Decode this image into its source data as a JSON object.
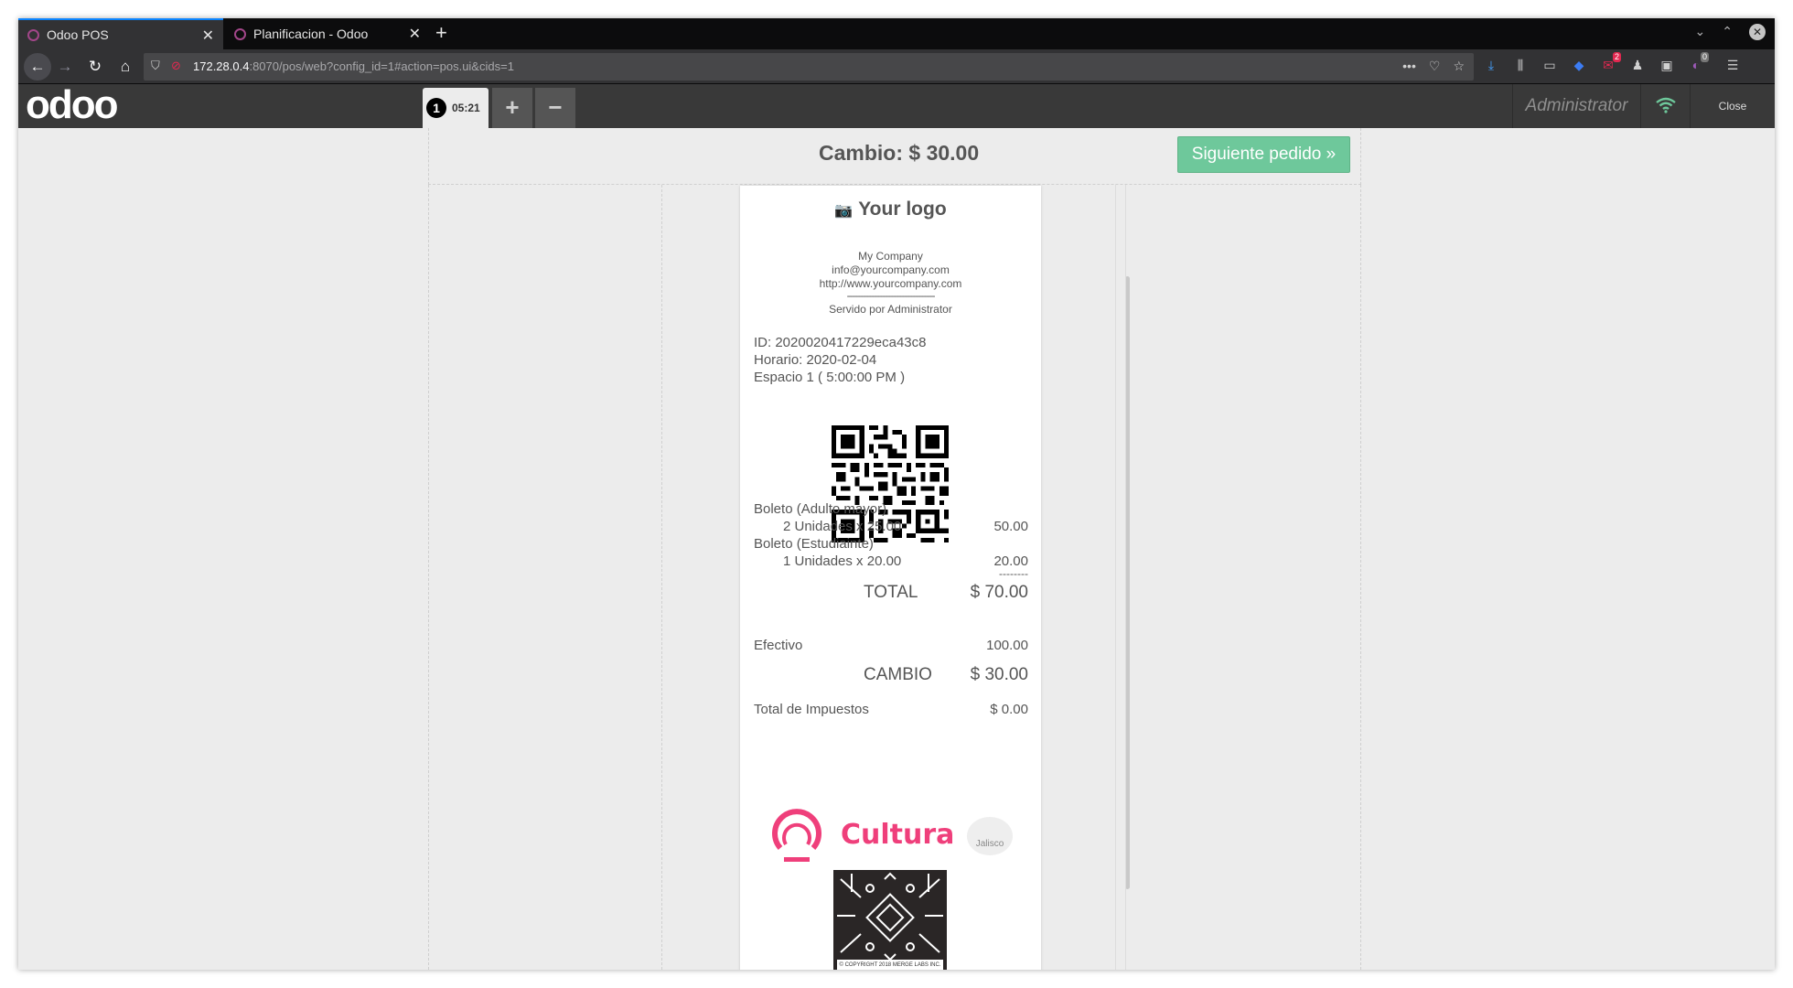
{
  "browser": {
    "tabs": [
      {
        "title": "Odoo POS",
        "active": true
      },
      {
        "title": "Planificacion - Odoo",
        "active": false
      }
    ],
    "url_host": "172.28.0.4",
    "url_rest": ":8070/pos/web?config_id=1#action=pos.ui&cids=1",
    "badges": {
      "mail": "2",
      "ext": "0"
    }
  },
  "pos": {
    "logo": "odoo",
    "order_number": "1",
    "order_time": "05:21",
    "add_label": "+",
    "remove_label": "−",
    "user": "Administrator",
    "close_label": "Close",
    "wifi_color": "#6ec89b"
  },
  "screen": {
    "change_label": "Cambio: $ 30.00",
    "next_order_label": "Siguiente pedido »"
  },
  "receipt": {
    "logo_text": "Your logo",
    "company": "My Company",
    "email": "info@yourcompany.com",
    "website": "http://www.yourcompany.com",
    "separator": "--------------------------------",
    "served_by": "Servido por Administrator",
    "id_line": "ID: 2020020417229eca43c8",
    "schedule_line": "Horario: 2020-02-04",
    "space_line": "Espacio 1 ( 5:00:00 PM )",
    "lines": [
      {
        "product": "Boleto (Adulto mayor)",
        "qty": "2 Unidades x 25.00",
        "amount": "50.00"
      },
      {
        "product": "Boleto (Estudiainte)",
        "qty": "1 Unidades x 20.00",
        "amount": "20.00"
      }
    ],
    "subtotal_sep": "--------",
    "total_label": "TOTAL",
    "total_value": "$ 70.00",
    "payment_label": "Efectivo",
    "payment_value": "100.00",
    "change_label": "CAMBIO",
    "change_value": "$ 30.00",
    "tax_label": "Total de Impuestos",
    "tax_value": "$ 0.00",
    "brand_text": "Cultura",
    "brand_color": "#ef3f7b",
    "partner_text": "Jalisco",
    "art_caption": "© COPYRIGHT 2018 MERGE LABS INC."
  }
}
